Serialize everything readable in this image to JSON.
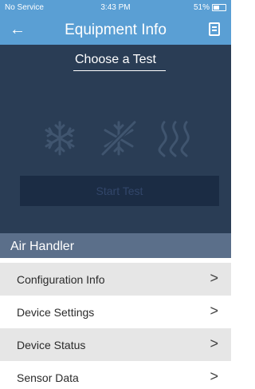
{
  "status": {
    "carrier": "No Service",
    "time": "3:43 PM",
    "battery_text": "51%"
  },
  "nav": {
    "back_glyph": "←",
    "title": "Equipment Info"
  },
  "test_panel": {
    "title": "Choose a Test",
    "modes": [
      {
        "icon": "snowflake-icon"
      },
      {
        "icon": "defrost-snowflake-icon"
      },
      {
        "icon": "heat-waves-icon"
      }
    ],
    "start_label": "Start Test"
  },
  "section": {
    "title": "Air Handler"
  },
  "menu": [
    {
      "label": "Configuration Info",
      "chevron": ">"
    },
    {
      "label": "Device Settings",
      "chevron": ">"
    },
    {
      "label": "Device Status",
      "chevron": ">"
    },
    {
      "label": "Sensor Data",
      "chevron": ">"
    }
  ],
  "colors": {
    "header_blue": "#5a9fd4",
    "panel_navy": "#2a3d55",
    "section_slate": "#5b6f8a",
    "row_gray": "#e6e6e6",
    "row_white": "#ffffff"
  }
}
